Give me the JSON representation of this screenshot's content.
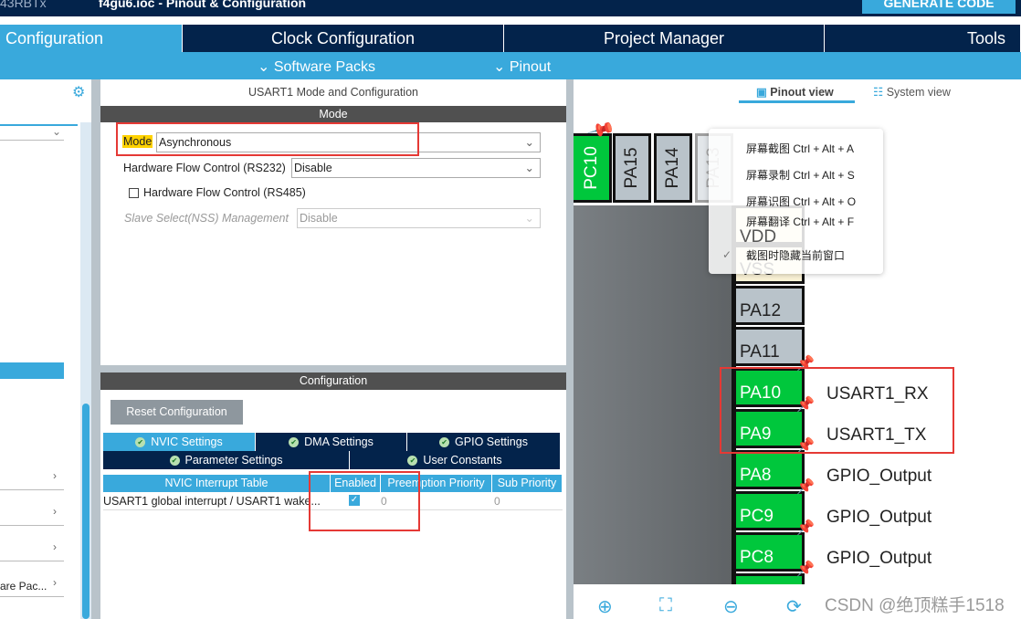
{
  "titlebar": {
    "device": "43RBTx",
    "file": "f4gu6.ioc - Pinout & Configuration",
    "generate": "GENERATE CODE"
  },
  "tabs": [
    {
      "label": "Configuration"
    },
    {
      "label": "Clock Configuration"
    },
    {
      "label": "Project Manager"
    },
    {
      "label": "Tools"
    }
  ],
  "subbar": {
    "software_packs": "Software Packs",
    "pinout": "Pinout"
  },
  "sidebar": {
    "truncated_item": "are Pac..."
  },
  "mode_panel": {
    "title": "USART1 Mode and Configuration",
    "section": "Mode",
    "mode_label": "Mode",
    "mode_value": "Asynchronous",
    "hfc232_label": "Hardware Flow Control (RS232)",
    "hfc232_value": "Disable",
    "hfc485_label": "Hardware Flow Control (RS485)",
    "nss_label": "Slave Select(NSS) Management",
    "nss_value": "Disable"
  },
  "config_panel": {
    "section": "Configuration",
    "reset": "Reset Configuration",
    "tabs": [
      "NVIC Settings",
      "DMA Settings",
      "GPIO Settings",
      "Parameter Settings",
      "User Constants"
    ],
    "table": {
      "headers": [
        "NVIC Interrupt Table",
        "Enabled",
        "Preemption Priority",
        "Sub Priority"
      ],
      "rows": [
        {
          "name": "USART1 global interrupt / USART1 wake...",
          "enabled": true,
          "preemption": "0",
          "sub": "0"
        }
      ]
    }
  },
  "pinout": {
    "views": {
      "pinout": "Pinout view",
      "system": "System view"
    },
    "top_pins": [
      "PC10",
      "PA15",
      "PA14",
      "PA13"
    ],
    "side_pins": [
      {
        "name": "VDD",
        "signal": ""
      },
      {
        "name": "VSS",
        "signal": ""
      },
      {
        "name": "PA12",
        "signal": ""
      },
      {
        "name": "PA11",
        "signal": ""
      },
      {
        "name": "PA10",
        "signal": "USART1_RX"
      },
      {
        "name": "PA9",
        "signal": "USART1_TX"
      },
      {
        "name": "PA8",
        "signal": "GPIO_Output"
      },
      {
        "name": "PC9",
        "signal": "GPIO_Output"
      },
      {
        "name": "PC8",
        "signal": "GPIO_Output"
      }
    ]
  },
  "context_menu": [
    "屏幕截图 Ctrl + Alt + A",
    "屏幕录制 Ctrl + Alt + S",
    "屏幕识图 Ctrl + Alt + O",
    "屏幕翻译 Ctrl + Alt + F",
    "截图时隐藏当前窗口"
  ],
  "watermark": "CSDN @绝顶糕手1518"
}
